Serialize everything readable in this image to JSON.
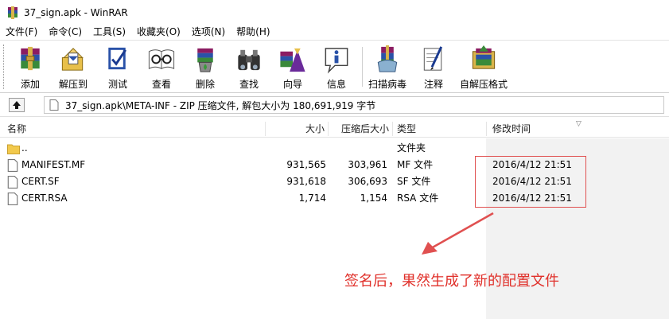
{
  "window": {
    "title": "37_sign.apk - WinRAR"
  },
  "menu": [
    "文件(F)",
    "命令(C)",
    "工具(S)",
    "收藏夹(O)",
    "选项(N)",
    "帮助(H)"
  ],
  "toolbar": {
    "items": [
      {
        "label": "添加",
        "icon": "add-archive-icon"
      },
      {
        "label": "解压到",
        "icon": "extract-to-icon"
      },
      {
        "label": "测试",
        "icon": "test-icon"
      },
      {
        "label": "查看",
        "icon": "view-icon"
      },
      {
        "label": "删除",
        "icon": "delete-icon"
      },
      {
        "label": "查找",
        "icon": "find-icon"
      },
      {
        "label": "向导",
        "icon": "wizard-icon"
      },
      {
        "label": "信息",
        "icon": "info-icon"
      },
      {
        "label": "扫描病毒",
        "icon": "virus-scan-icon"
      },
      {
        "label": "注释",
        "icon": "comment-icon"
      },
      {
        "label": "自解压格式",
        "icon": "sfx-icon"
      }
    ]
  },
  "address": {
    "text": "37_sign.apk\\META-INF - ZIP 压缩文件, 解包大小为 180,691,919 字节"
  },
  "columns": {
    "name": "名称",
    "size": "大小",
    "packed": "压缩后大小",
    "type": "类型",
    "modified": "修改时间"
  },
  "files": [
    {
      "name": "..",
      "size": "",
      "packed": "",
      "type": "文件夹",
      "modified": "",
      "kind": "folder"
    },
    {
      "name": "MANIFEST.MF",
      "size": "931,565",
      "packed": "303,961",
      "type": "MF 文件",
      "modified": "2016/4/12 21:51",
      "kind": "file"
    },
    {
      "name": "CERT.SF",
      "size": "931,618",
      "packed": "306,693",
      "type": "SF 文件",
      "modified": "2016/4/12 21:51",
      "kind": "file"
    },
    {
      "name": "CERT.RSA",
      "size": "1,714",
      "packed": "1,154",
      "type": "RSA 文件",
      "modified": "2016/4/12 21:51",
      "kind": "file"
    }
  ],
  "annotation": {
    "text": "签名后，果然生成了新的配置文件",
    "color": "#e0302a"
  }
}
